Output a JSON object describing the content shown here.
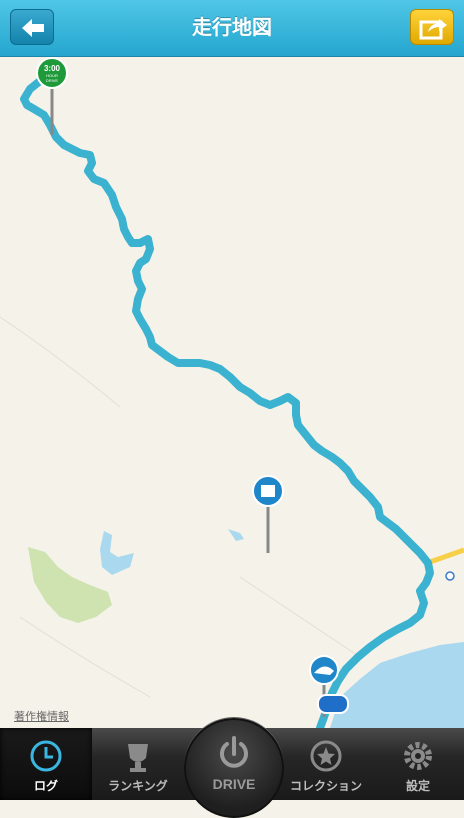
{
  "header": {
    "title": "走行地図"
  },
  "map": {
    "credit": "著作権情報",
    "start_badge": {
      "line1": "3:00",
      "line2": "HOUR",
      "line3": "DRIVE"
    }
  },
  "tabbar": {
    "tabs": [
      {
        "label": "ログ",
        "icon": "clock-icon",
        "active": true
      },
      {
        "label": "ランキング",
        "icon": "trophy-icon",
        "active": false
      },
      {
        "label": "コレクション",
        "icon": "star-badge-icon",
        "active": false
      },
      {
        "label": "設定",
        "icon": "gear-icon",
        "active": false
      }
    ],
    "drive_label": "DRIVE"
  },
  "colors": {
    "header": "#25a6cf",
    "route": "#3bb2d0",
    "share_button": "#f2bd00"
  }
}
